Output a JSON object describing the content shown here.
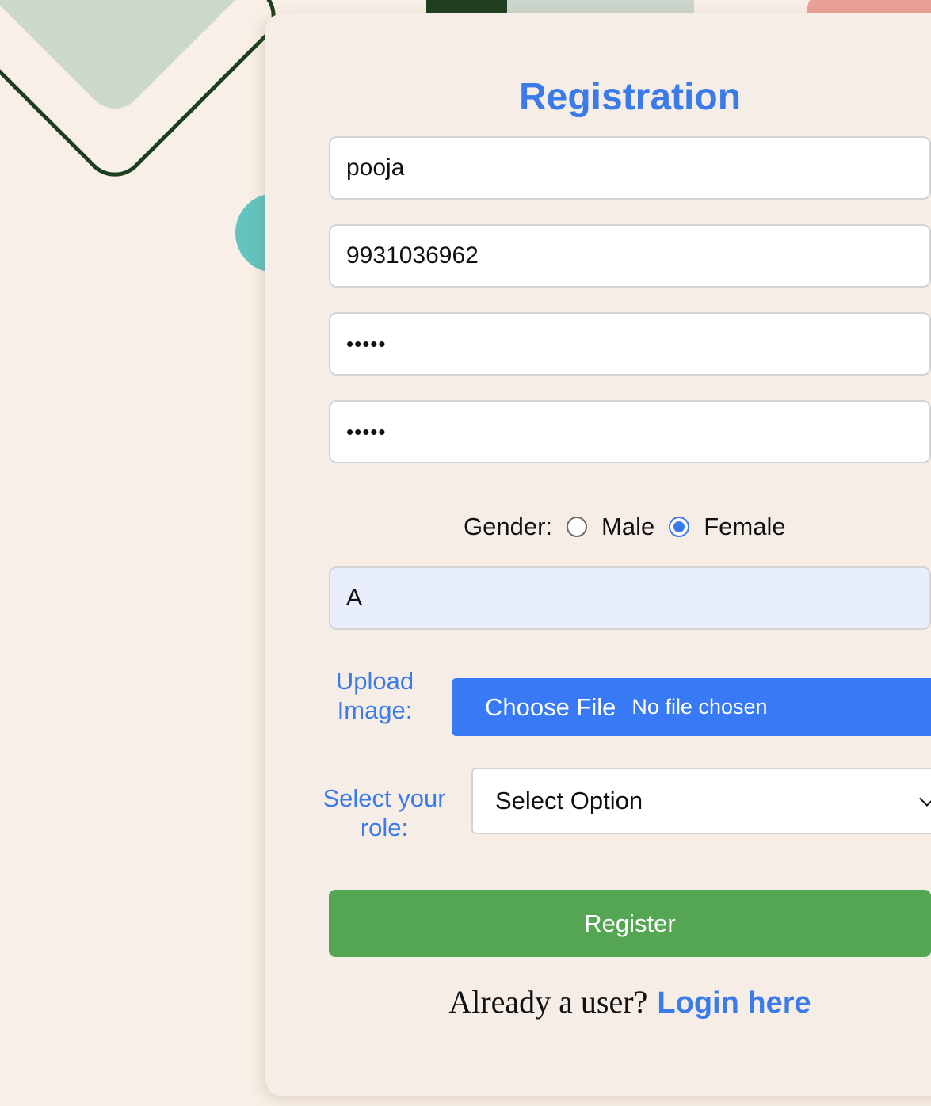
{
  "form": {
    "title": "Registration",
    "fields": {
      "name": "pooja",
      "phone": "9931036962",
      "password": "•••••",
      "confirm_password": "•••••",
      "address": "A"
    },
    "gender": {
      "label": "Gender:",
      "options": [
        "Male",
        "Female"
      ],
      "selected": "Female"
    },
    "upload": {
      "label_line1": "Upload",
      "label_line2": "Image:",
      "button_label": "Choose File",
      "status": "No file chosen"
    },
    "role": {
      "label_line1": "Select your",
      "label_line2": "role:",
      "selected": "Select Option"
    },
    "register_label": "Register",
    "login_prompt": "Already a user?",
    "login_link": "Login here"
  },
  "colors": {
    "accent": "#3b7be9",
    "register_button": "#54a653",
    "page_background": "#f8efe6",
    "card_background": "#f6ede6"
  }
}
